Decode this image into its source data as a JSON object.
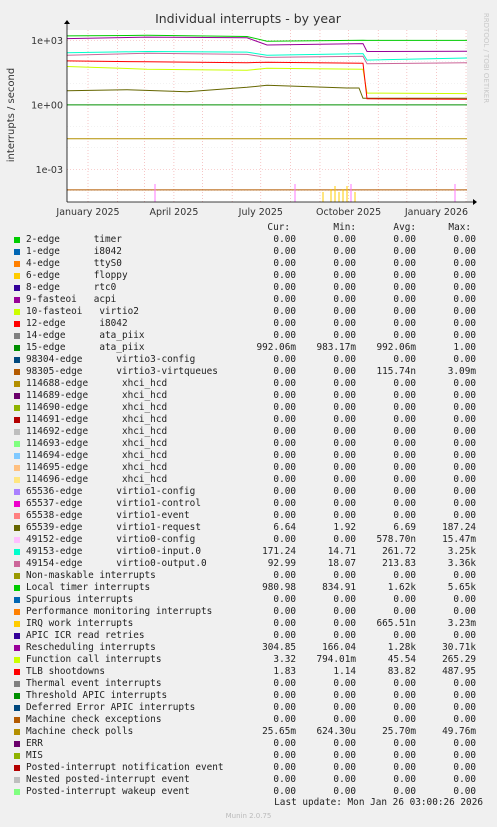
{
  "title": "Individual interrupts - by year",
  "ylabel": "interrupts / second",
  "watermark": "RRDTOOL / TOBI OETIKER",
  "columns": [
    "Cur:",
    "Min:",
    "Avg:",
    "Max:"
  ],
  "last_update": "Last update: Mon Jan 26 03:00:26 2026",
  "version": "Munin 2.0.75",
  "chart_data": {
    "type": "line",
    "title": "Individual interrupts - by year",
    "ylabel": "interrupts / second",
    "yscale": "log",
    "ylim": [
      3e-05,
      3000
    ],
    "ytick_labels": [
      "1e+03",
      "1e+00",
      "1e-03"
    ],
    "xlim": [
      "2024-12-10",
      "2026-02-02"
    ],
    "xtick_labels": [
      "January 2025",
      "April 2025",
      "July 2025",
      "October 2025",
      "January 2026"
    ],
    "grid": true,
    "legend": "bottom",
    "series": [
      {
        "name": "2-edge      timer",
        "color": "#00cc00",
        "cur": "0.00",
        "min": "0.00",
        "avg": "0.00",
        "max": "0.00"
      },
      {
        "name": "1-edge      i8042",
        "color": "#0066b3",
        "cur": "0.00",
        "min": "0.00",
        "avg": "0.00",
        "max": "0.00"
      },
      {
        "name": "4-edge      ttyS0",
        "color": "#ff8000",
        "cur": "0.00",
        "min": "0.00",
        "avg": "0.00",
        "max": "0.00"
      },
      {
        "name": "6-edge      floppy",
        "color": "#ffcc00",
        "cur": "0.00",
        "min": "0.00",
        "avg": "0.00",
        "max": "0.00"
      },
      {
        "name": "8-edge      rtc0",
        "color": "#330099",
        "cur": "0.00",
        "min": "0.00",
        "avg": "0.00",
        "max": "0.00"
      },
      {
        "name": "9-fasteoi   acpi",
        "color": "#990099",
        "cur": "0.00",
        "min": "0.00",
        "avg": "0.00",
        "max": "0.00"
      },
      {
        "name": "10-fasteoi   virtio2",
        "color": "#ccff00",
        "cur": "0.00",
        "min": "0.00",
        "avg": "0.00",
        "max": "0.00"
      },
      {
        "name": "12-edge      i8042",
        "color": "#ff0000",
        "cur": "0.00",
        "min": "0.00",
        "avg": "0.00",
        "max": "0.00"
      },
      {
        "name": "14-edge      ata_piix",
        "color": "#808080",
        "cur": "0.00",
        "min": "0.00",
        "avg": "0.00",
        "max": "0.00"
      },
      {
        "name": "15-edge      ata_piix",
        "color": "#008f00",
        "cur": "992.06m",
        "min": "983.17m",
        "avg": "992.06m",
        "max": "1.00",
        "line": [
          [
            0,
            0.99
          ],
          [
            1,
            0.99
          ]
        ]
      },
      {
        "name": "98304-edge      virtio3-config",
        "color": "#00487d",
        "cur": "0.00",
        "min": "0.00",
        "avg": "0.00",
        "max": "0.00"
      },
      {
        "name": "98305-edge      virtio3-virtqueues",
        "color": "#b35a00",
        "cur": "0.00",
        "min": "0.00",
        "avg": "115.74n",
        "max": "3.09m",
        "line": [
          [
            0,
            0.00011
          ],
          [
            1,
            0.00011
          ]
        ]
      },
      {
        "name": "114688-edge      xhci_hcd",
        "color": "#b38f00",
        "cur": "0.00",
        "min": "0.00",
        "avg": "0.00",
        "max": "0.00"
      },
      {
        "name": "114689-edge      xhci_hcd",
        "color": "#6b006b",
        "cur": "0.00",
        "min": "0.00",
        "avg": "0.00",
        "max": "0.00"
      },
      {
        "name": "114690-edge      xhci_hcd",
        "color": "#8fb300",
        "cur": "0.00",
        "min": "0.00",
        "avg": "0.00",
        "max": "0.00"
      },
      {
        "name": "114691-edge      xhci_hcd",
        "color": "#b30000",
        "cur": "0.00",
        "min": "0.00",
        "avg": "0.00",
        "max": "0.00"
      },
      {
        "name": "114692-edge      xhci_hcd",
        "color": "#bebebe",
        "cur": "0.00",
        "min": "0.00",
        "avg": "0.00",
        "max": "0.00"
      },
      {
        "name": "114693-edge      xhci_hcd",
        "color": "#80ff80",
        "cur": "0.00",
        "min": "0.00",
        "avg": "0.00",
        "max": "0.00"
      },
      {
        "name": "114694-edge      xhci_hcd",
        "color": "#80c9ff",
        "cur": "0.00",
        "min": "0.00",
        "avg": "0.00",
        "max": "0.00"
      },
      {
        "name": "114695-edge      xhci_hcd",
        "color": "#ffc080",
        "cur": "0.00",
        "min": "0.00",
        "avg": "0.00",
        "max": "0.00"
      },
      {
        "name": "114696-edge      xhci_hcd",
        "color": "#ffe680",
        "cur": "0.00",
        "min": "0.00",
        "avg": "0.00",
        "max": "0.00"
      },
      {
        "name": "65536-edge      virtio1-config",
        "color": "#aa80ff",
        "cur": "0.00",
        "min": "0.00",
        "avg": "0.00",
        "max": "0.00"
      },
      {
        "name": "65537-edge      virtio1-control",
        "color": "#ee00cc",
        "cur": "0.00",
        "min": "0.00",
        "avg": "0.00",
        "max": "0.00"
      },
      {
        "name": "65538-edge      virtio1-event",
        "color": "#ff8080",
        "cur": "0.00",
        "min": "0.00",
        "avg": "0.00",
        "max": "0.00"
      },
      {
        "name": "65539-edge      virtio1-request",
        "color": "#666600",
        "cur": "6.64",
        "min": "1.92",
        "avg": "6.69",
        "max": "187.24",
        "line": [
          [
            0,
            4.5
          ],
          [
            0.15,
            5.0
          ],
          [
            0.3,
            4.0
          ],
          [
            0.45,
            6.5
          ],
          [
            0.5,
            8.0
          ],
          [
            0.7,
            6.0
          ],
          [
            0.73,
            6.0
          ],
          [
            0.74,
            2.0
          ],
          [
            1,
            2.0
          ]
        ]
      },
      {
        "name": "49152-edge      virtio0-config",
        "color": "#ffbfff",
        "cur": "0.00",
        "min": "0.00",
        "avg": "578.70n",
        "max": "15.47m"
      },
      {
        "name": "49153-edge      virtio0-input.0",
        "color": "#00ffcc",
        "cur": "171.24",
        "min": "14.71",
        "avg": "261.72",
        "max": "3.25k",
        "line": [
          [
            0,
            260
          ],
          [
            0.2,
            300
          ],
          [
            0.45,
            280
          ],
          [
            0.5,
            200
          ],
          [
            0.74,
            240
          ],
          [
            0.75,
            120
          ],
          [
            1,
            150
          ]
        ]
      },
      {
        "name": "49154-edge      virtio0-output.0",
        "color": "#cc6699",
        "cur": "92.99",
        "min": "18.07",
        "avg": "213.83",
        "max": "3.36k",
        "line": [
          [
            0,
            200
          ],
          [
            0.2,
            250
          ],
          [
            0.45,
            220
          ],
          [
            0.5,
            160
          ],
          [
            0.74,
            180
          ],
          [
            0.75,
            80
          ],
          [
            1,
            90
          ]
        ]
      },
      {
        "name": "Non-maskable interrupts",
        "color": "#999900",
        "cur": "0.00",
        "min": "0.00",
        "avg": "0.00",
        "max": "0.00"
      },
      {
        "name": "Local timer interrupts",
        "color": "#00cc00",
        "cur": "980.98",
        "min": "834.91",
        "avg": "1.62k",
        "max": "5.65k",
        "line": [
          [
            0,
            1600
          ],
          [
            0.2,
            1700
          ],
          [
            0.45,
            1500
          ],
          [
            0.5,
            900
          ],
          [
            0.74,
            1000
          ],
          [
            0.75,
            980
          ],
          [
            1,
            980
          ]
        ]
      },
      {
        "name": "Spurious interrupts",
        "color": "#0066b3",
        "cur": "0.00",
        "min": "0.00",
        "avg": "0.00",
        "max": "0.00"
      },
      {
        "name": "Performance monitoring interrupts",
        "color": "#ff8000",
        "cur": "0.00",
        "min": "0.00",
        "avg": "0.00",
        "max": "0.00"
      },
      {
        "name": "IRQ work interrupts",
        "color": "#ffcc00",
        "cur": "0.00",
        "min": "0.00",
        "avg": "665.51n",
        "max": "3.23m"
      },
      {
        "name": "APIC ICR read retries",
        "color": "#330099",
        "cur": "0.00",
        "min": "0.00",
        "avg": "0.00",
        "max": "0.00"
      },
      {
        "name": "Rescheduling interrupts",
        "color": "#990099",
        "cur": "304.85",
        "min": "166.04",
        "avg": "1.28k",
        "max": "30.71k",
        "line": [
          [
            0,
            1200
          ],
          [
            0.2,
            1400
          ],
          [
            0.45,
            1300
          ],
          [
            0.5,
            600
          ],
          [
            0.74,
            700
          ],
          [
            0.75,
            300
          ],
          [
            1,
            310
          ]
        ]
      },
      {
        "name": "Function call interrupts",
        "color": "#ccff00",
        "cur": "3.32",
        "min": "794.01m",
        "avg": "45.54",
        "max": "265.29",
        "line": [
          [
            0,
            60
          ],
          [
            0.2,
            45
          ],
          [
            0.45,
            40
          ],
          [
            0.5,
            50
          ],
          [
            0.74,
            45
          ],
          [
            0.75,
            3.5
          ],
          [
            1,
            3.3
          ]
        ]
      },
      {
        "name": "TLB shootdowns",
        "color": "#ff0000",
        "cur": "1.83",
        "min": "1.14",
        "avg": "83.82",
        "max": "487.95",
        "line": [
          [
            0,
            110
          ],
          [
            0.2,
            100
          ],
          [
            0.45,
            90
          ],
          [
            0.5,
            95
          ],
          [
            0.74,
            85
          ],
          [
            0.75,
            1.9
          ],
          [
            1,
            1.8
          ]
        ]
      },
      {
        "name": "Thermal event interrupts",
        "color": "#808080",
        "cur": "0.00",
        "min": "0.00",
        "avg": "0.00",
        "max": "0.00"
      },
      {
        "name": "Threshold APIC interrupts",
        "color": "#008f00",
        "cur": "0.00",
        "min": "0.00",
        "avg": "0.00",
        "max": "0.00"
      },
      {
        "name": "Deferred Error APIC interrupts",
        "color": "#00487d",
        "cur": "0.00",
        "min": "0.00",
        "avg": "0.00",
        "max": "0.00"
      },
      {
        "name": "Machine check exceptions",
        "color": "#b35a00",
        "cur": "0.00",
        "min": "0.00",
        "avg": "0.00",
        "max": "0.00"
      },
      {
        "name": "Machine check polls",
        "color": "#b38f00",
        "cur": "25.65m",
        "min": "624.30u",
        "avg": "25.70m",
        "max": "49.76m",
        "line": [
          [
            0,
            0.026
          ],
          [
            1,
            0.026
          ]
        ]
      },
      {
        "name": "ERR",
        "color": "#6b006b",
        "cur": "0.00",
        "min": "0.00",
        "avg": "0.00",
        "max": "0.00"
      },
      {
        "name": "MIS",
        "color": "#8fb300",
        "cur": "0.00",
        "min": "0.00",
        "avg": "0.00",
        "max": "0.00"
      },
      {
        "name": "Posted-interrupt notification event",
        "color": "#b30000",
        "cur": "0.00",
        "min": "0.00",
        "avg": "0.00",
        "max": "0.00"
      },
      {
        "name": "Nested posted-interrupt event",
        "color": "#bebebe",
        "cur": "0.00",
        "min": "0.00",
        "avg": "0.00",
        "max": "0.00"
      },
      {
        "name": "Posted-interrupt wakeup event",
        "color": "#80ff80",
        "cur": "0.00",
        "min": "0.00",
        "avg": "0.00",
        "max": "0.00"
      }
    ]
  }
}
